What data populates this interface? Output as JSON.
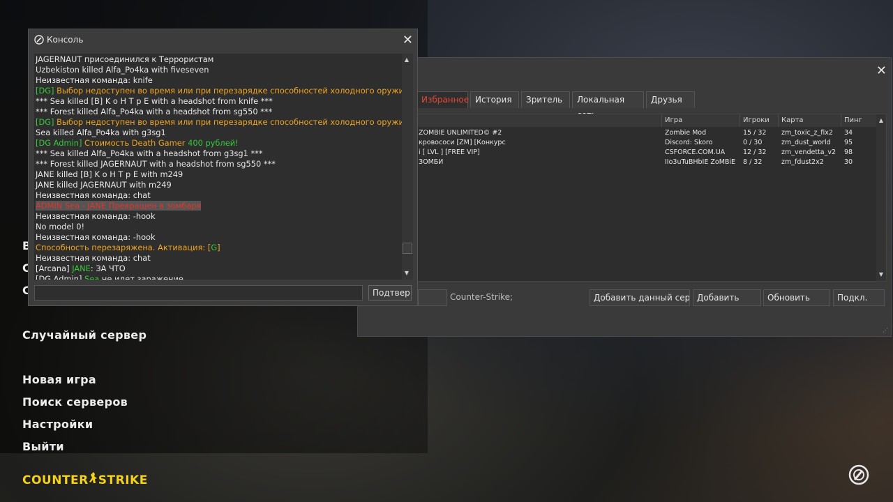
{
  "main_menu": {
    "partial_items": [
      "В",
      "С",
      "С"
    ],
    "random_server": "Случайный сервер",
    "new_game": "Новая игра",
    "find_servers": "Поиск серверов",
    "settings": "Настройки",
    "quit": "Выйти"
  },
  "logo": {
    "part1": "Counter",
    "part2": "Strike"
  },
  "server_browser": {
    "tabs": [
      "Избранное",
      "История",
      "Зритель",
      "Локальная сеть",
      "Друзья"
    ],
    "columns": [
      "Игра",
      "Игроки",
      "Карта",
      "Пинг"
    ],
    "servers": [
      {
        "name": "ZOMBIE UNLIMITED© #2",
        "game": "Zombie Mod",
        "players": "15 / 32",
        "map": "zm_toxic_z_fix2",
        "ping": "34"
      },
      {
        "name": "кровососи [ZM] [Конкурс",
        "game": "Discord: Skoro",
        "players": "0 / 30",
        "map": "zm_dust_world",
        "ping": "95"
      },
      {
        "name": "i [ LVL ] [FREE VIP]",
        "game": "CSFORCE.COM.UA",
        "players": "12 / 32",
        "map": "zm_vendetta_v2",
        "ping": "98"
      },
      {
        "name": "ЗОМБИ",
        "game": "IIo3uTuBHbIE ZoMBiE",
        "players": "8 / 32",
        "map": "zm_fdust2x2",
        "ping": "30"
      }
    ],
    "filter_text": "Counter-Strike;",
    "buttons": {
      "add_current": "Добавить данный серве",
      "add": "Добавить",
      "refresh": "Обновить",
      "connect": "Подкл."
    }
  },
  "console": {
    "title": "Консоль",
    "submit": "Подтвер.",
    "lines": [
      [
        {
          "t": "JAGERNAUT присоединился к Террористам",
          "c": "w"
        }
      ],
      [
        {
          "t": "Uzbekiston killed Alfa_Po4ka with fiveseven",
          "c": "w"
        }
      ],
      [
        {
          "t": "Неизвестная команда: knife",
          "c": "w"
        }
      ],
      [
        {
          "t": "[DG] ",
          "c": "g"
        },
        {
          "t": "Выбор недоступен во время или при перезарядке способностей холодного оружия!",
          "c": "o"
        }
      ],
      [
        {
          "t": "*** Sea killed [B] K o H T p E with a headshot from knife ***",
          "c": "w"
        }
      ],
      [
        {
          "t": "*** Forest killed Alfa_Po4ka with a headshot from sg550 ***",
          "c": "w"
        }
      ],
      [
        {
          "t": "[DG] ",
          "c": "g"
        },
        {
          "t": "Выбор недоступен во время или при перезарядке способностей холодного оружия!",
          "c": "o"
        }
      ],
      [
        {
          "t": "Sea killed Alfa_Po4ka with g3sg1",
          "c": "w"
        }
      ],
      [
        {
          "t": "[DG Admin] ",
          "c": "g"
        },
        {
          "t": "Стоимость Death Gamer ",
          "c": "o"
        },
        {
          "t": "400 рублей!",
          "c": "g"
        }
      ],
      [
        {
          "t": "*** Sea killed Alfa_Po4ka with a headshot from g3sg1 ***",
          "c": "w"
        }
      ],
      [
        {
          "t": "*** Forest killed JAGERNAUT with a headshot from sg550 ***",
          "c": "w"
        }
      ],
      [
        {
          "t": "JANE killed [B] K o H T p E with m249",
          "c": "w"
        }
      ],
      [
        {
          "t": "JANE killed JAGERNAUT with m249",
          "c": "w"
        }
      ],
      [
        {
          "t": "Неизвестная команда: chat",
          "c": "w"
        }
      ],
      [
        {
          "t": "ADMIN Sea - JANE Превращен в зомбаря",
          "c": "r",
          "hl": true
        }
      ],
      [
        {
          "t": "Неизвестная команда: -hook",
          "c": "w"
        }
      ],
      [
        {
          "t": "No model 0!",
          "c": "w"
        }
      ],
      [
        {
          "t": "Неизвестная команда: -hook",
          "c": "w"
        }
      ],
      [
        {
          "t": "Способность перезаряжена. Активация: [",
          "c": "o"
        },
        {
          "t": "G",
          "c": "g"
        },
        {
          "t": "]",
          "c": "o"
        }
      ],
      [
        {
          "t": "Неизвестная команда: chat",
          "c": "w"
        }
      ],
      [
        {
          "t": "[Arcana] ",
          "c": "w"
        },
        {
          "t": "JANE",
          "c": "g"
        },
        {
          "t": ": ЗА ЧТО",
          "c": "w"
        }
      ],
      [
        {
          "t": "[DG Admin] ",
          "c": "w"
        },
        {
          "t": "Sea",
          "c": "g"
        },
        {
          "t": " не идет заражение",
          "c": "w"
        }
      ]
    ]
  },
  "colors": {
    "w": "#e8e8e8",
    "g": "#36c93a",
    "o": "#f0a620",
    "r": "#e0362c",
    "logo": "#f5d21a",
    "tab_active": "#e04a3a"
  }
}
